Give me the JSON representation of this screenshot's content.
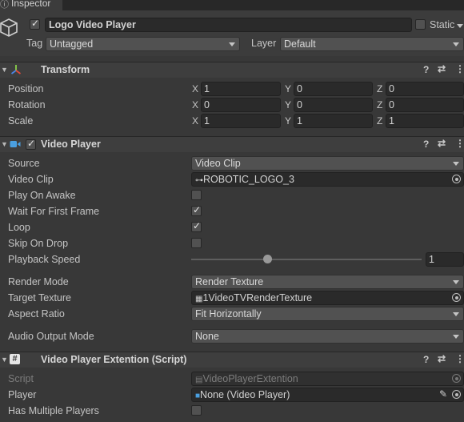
{
  "tab": {
    "title": "Inspector"
  },
  "object": {
    "active": true,
    "name": "Logo Video Player",
    "static_label": "Static",
    "static": false,
    "tag_label": "Tag",
    "tag_value": "Untagged",
    "layer_label": "Layer",
    "layer_value": "Default"
  },
  "transform": {
    "title": "Transform",
    "rows": [
      {
        "label": "Position",
        "x": "1",
        "y": "0",
        "z": "0"
      },
      {
        "label": "Rotation",
        "x": "0",
        "y": "0",
        "z": "0"
      },
      {
        "label": "Scale",
        "x": "1",
        "y": "1",
        "z": "1"
      }
    ],
    "axis_x": "X",
    "axis_y": "Y",
    "axis_z": "Z"
  },
  "video_player": {
    "title": "Video Player",
    "enabled": true,
    "source_label": "Source",
    "source_value": "Video Clip",
    "clip_label": "Video Clip",
    "clip_value": "ROBOTIC_LOGO_3",
    "play_on_awake_label": "Play On Awake",
    "play_on_awake": false,
    "wait_first_frame_label": "Wait For First Frame",
    "wait_first_frame": true,
    "loop_label": "Loop",
    "loop": true,
    "skip_on_drop_label": "Skip On Drop",
    "skip_on_drop": false,
    "playback_speed_label": "Playback Speed",
    "playback_speed_value": "1",
    "playback_speed_fraction": 0.33,
    "render_mode_label": "Render Mode",
    "render_mode_value": "Render Texture",
    "target_texture_label": "Target Texture",
    "target_texture_value": "1VideoTVRenderTexture",
    "aspect_ratio_label": "Aspect Ratio",
    "aspect_ratio_value": "Fit Horizontally",
    "audio_output_label": "Audio Output Mode",
    "audio_output_value": "None"
  },
  "script_comp": {
    "title": "Video Player Extention (Script)",
    "script_label": "Script",
    "script_value": "VideoPlayerExtention",
    "player_label": "Player",
    "player_value": "None (Video Player)",
    "multi_label": "Has Multiple Players",
    "multi": false
  },
  "colors": {
    "background": "#383838",
    "field": "#2a2a2a",
    "header": "#3e3e3e",
    "vp_icon": "#4a9fe0",
    "transform_x": "#e04a3c",
    "transform_y": "#8bd14a",
    "transform_z": "#4a86e8"
  },
  "icons": [
    "inspector-icon",
    "gameobject-cube-icon",
    "transform-icon",
    "video-player-icon",
    "script-icon",
    "help-icon",
    "preset-icon",
    "kebab-menu-icon",
    "object-picker-icon",
    "pencil-icon",
    "video-clip-icon",
    "render-texture-icon"
  ]
}
